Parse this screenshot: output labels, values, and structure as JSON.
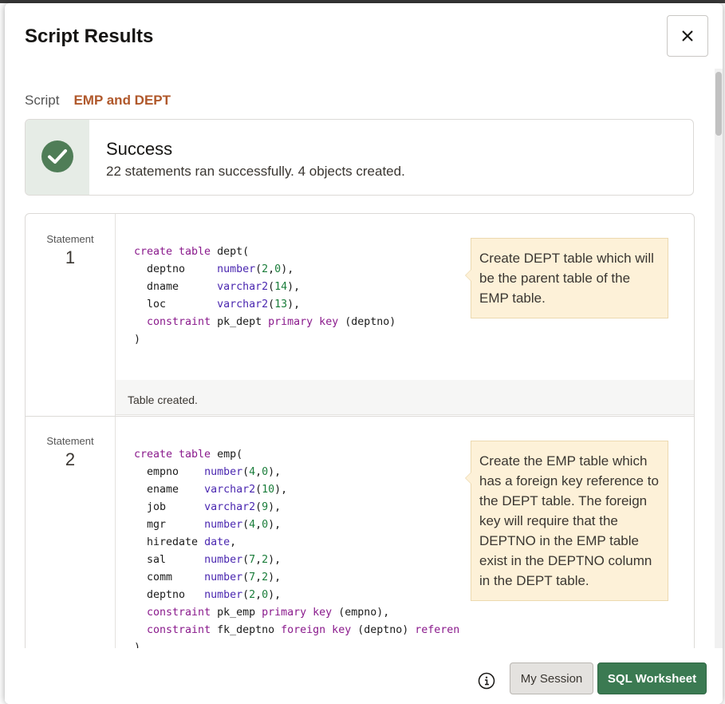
{
  "dialog": {
    "title": "Script Results",
    "close_icon": "close-icon"
  },
  "script": {
    "label": "Script",
    "name": "EMP and DEPT"
  },
  "success": {
    "icon": "check-circle-icon",
    "title": "Success",
    "message": "22 statements ran successfully. 4 objects created."
  },
  "statements": [
    {
      "label": "Statement",
      "number": "1",
      "callout": "Create DEPT table which will be the parent table of the EMP table.",
      "result": "Table created."
    },
    {
      "label": "Statement",
      "number": "2",
      "callout": "Create the EMP table which has a foreign key reference to the DEPT table. The foreign key will require that the DEPTNO in the EMP table exist in the DEPTNO column in the DEPT table."
    }
  ],
  "footer": {
    "info_icon": "info-icon",
    "session_label": "My Session",
    "sql_label": "SQL Worksheet"
  },
  "colors": {
    "success_green": "#4f7d57",
    "primary_button": "#3b7a52",
    "script_name": "#b0582b",
    "callout_bg": "#fdf1d8"
  }
}
